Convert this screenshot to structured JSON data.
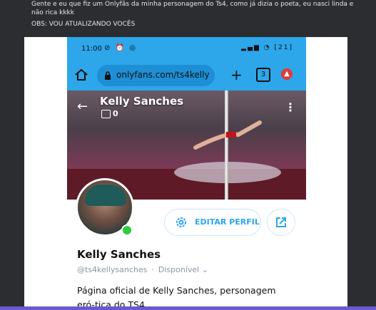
{
  "post": {
    "text_line1": "Gente e eu que fiz um Onlyfãs da minha personagem do Ts4, como já dizia o poeta, eu nasci linda e não rica kkkk",
    "text_line2": "OBS: VOU ATUALIZANDO VOCÊS"
  },
  "statusbar": {
    "time": "11:00",
    "battery": "21"
  },
  "browser": {
    "url": "onlyfans.com/ts4kelly",
    "tab_count": "3",
    "alert_glyph": "▲"
  },
  "profile": {
    "banner_name": "Kelly Sanches",
    "media_count": "0",
    "name": "Kelly Sanches",
    "handle": "@ts4kellysanches",
    "availability": "Disponível",
    "edit_label": "EDITAR PERFIL",
    "bio": "Página oficial de Kelly Sanches, personagem eró-tica do TS4"
  },
  "colors": {
    "accent": "#2da6ea",
    "online": "#2ecc40",
    "discord_bg": "#2b2d31"
  }
}
